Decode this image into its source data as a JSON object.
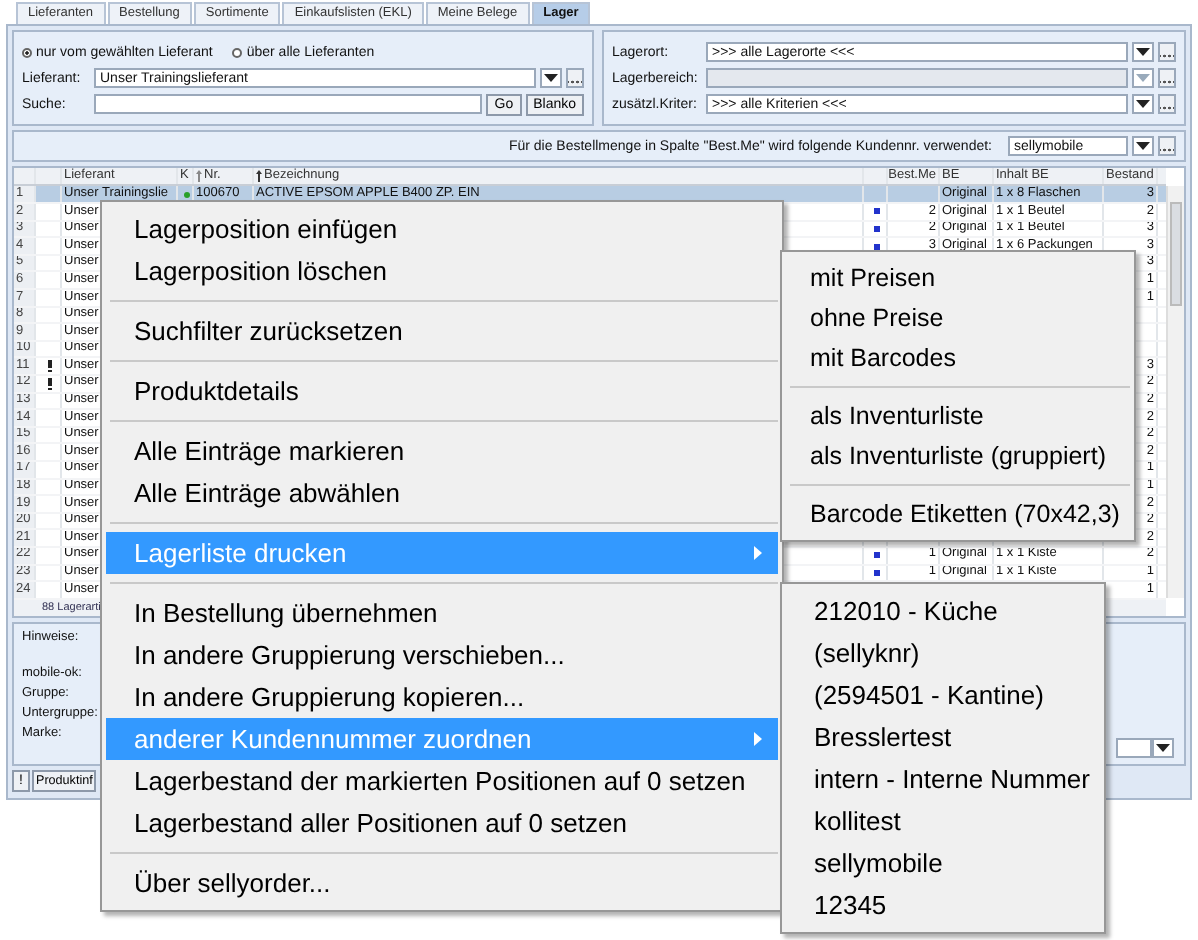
{
  "tabs": [
    {
      "label": "Lieferanten",
      "selected": false
    },
    {
      "label": "Bestellung",
      "selected": false
    },
    {
      "label": "Sortimente",
      "selected": false
    },
    {
      "label": "Einkaufslisten (EKL)",
      "selected": false
    },
    {
      "label": "Meine Belege",
      "selected": false
    },
    {
      "label": "Lager",
      "selected": true
    }
  ],
  "filter": {
    "radios": [
      {
        "label": "nur vom gewählten Lieferant",
        "selected": true
      },
      {
        "label": "über alle Lieferanten",
        "selected": false
      }
    ],
    "lieferant_label": "Lieferant:",
    "lieferant_value": "Unser Trainingslieferant",
    "search_label": "Suche:",
    "go_button": "Go",
    "blank_button": "Blanko"
  },
  "storage": {
    "fields": [
      {
        "label": "Lagerort:",
        "value": ">>> alle Lagerorte <<<",
        "disabled": false
      },
      {
        "label": "Lagerbereich:",
        "disabled": true
      },
      {
        "label": "zusätzl.Kriter:",
        "value": ">>> alle Kriterien <<<",
        "disabled": false
      }
    ]
  },
  "customer": {
    "label": "Für die Bestellmenge in Spalte \"Best.Me\" wird folgende Kundennr. verwendet:",
    "value": "sellymobile"
  },
  "table": {
    "columns": [
      "Lieferant",
      "K",
      "Nr.",
      "Bezeichnung",
      "Best.Me",
      "BE",
      "Inhalt BE",
      "Bestand"
    ],
    "rows": [
      {
        "n": "1",
        "warning": false,
        "lieferant": "Unser Trainingslie",
        "k_ok": true,
        "nr": "100670",
        "bezeichnung": "ACTIVE EPSOM APPLE B400 ZP. EIN",
        "marked": false,
        "be": "Original",
        "inhalt": "1 x 8 Flaschen",
        "bestand": "3",
        "selected": true
      },
      {
        "n": "2",
        "warning": false,
        "lieferant": "Unser",
        "marked": true,
        "best_me": "2",
        "be": "Original",
        "inhalt": "1 x 1 Beutel",
        "bestand": "2",
        "selected": false
      },
      {
        "n": "3",
        "warning": false,
        "lieferant": "Unser",
        "marked": true,
        "best_me": "2",
        "be": "Original",
        "inhalt": "1 x 1 Beutel",
        "bestand": "3",
        "selected": false
      },
      {
        "n": "4",
        "warning": false,
        "lieferant": "Unser",
        "marked": true,
        "best_me": "3",
        "be": "Original",
        "inhalt": "1 x 6 Packungen",
        "bestand": "3",
        "selected": false
      },
      {
        "n": "5",
        "warning": false,
        "lieferant": "Unser",
        "bestand": "3",
        "selected": false
      },
      {
        "n": "6",
        "warning": false,
        "lieferant": "Unser",
        "bestand": "1",
        "selected": false
      },
      {
        "n": "7",
        "warning": false,
        "lieferant": "Unser",
        "bestand": "1",
        "selected": false
      },
      {
        "n": "8",
        "warning": false,
        "lieferant": "Unser",
        "selected": false
      },
      {
        "n": "9",
        "warning": false,
        "lieferant": "Unser",
        "selected": false
      },
      {
        "n": "10",
        "warning": false,
        "lieferant": "Unser",
        "selected": false
      },
      {
        "n": "11",
        "warning": true,
        "lieferant": "Unser",
        "bestand": "3",
        "selected": false
      },
      {
        "n": "12",
        "warning": true,
        "lieferant": "Unser",
        "bestand": "2",
        "selected": false
      },
      {
        "n": "13",
        "warning": false,
        "lieferant": "Unser",
        "bestand": "2",
        "selected": false
      },
      {
        "n": "14",
        "warning": false,
        "lieferant": "Unser",
        "bestand": "2",
        "selected": false
      },
      {
        "n": "15",
        "warning": false,
        "lieferant": "Unser",
        "bestand": "2",
        "selected": false
      },
      {
        "n": "16",
        "warning": false,
        "lieferant": "Unser",
        "bestand": "2",
        "selected": false
      },
      {
        "n": "17",
        "warning": false,
        "lieferant": "Unser",
        "bestand": "1",
        "selected": false
      },
      {
        "n": "18",
        "warning": false,
        "lieferant": "Unser",
        "bestand": "1",
        "selected": false
      },
      {
        "n": "19",
        "warning": false,
        "lieferant": "Unser",
        "bestand": "2",
        "selected": false
      },
      {
        "n": "20",
        "warning": false,
        "lieferant": "Unser",
        "bestand": "2",
        "selected": false
      },
      {
        "n": "21",
        "warning": false,
        "lieferant": "Unser",
        "bestand": "2",
        "selected": false
      },
      {
        "n": "22",
        "warning": false,
        "lieferant": "Unser",
        "marked": true,
        "best_me": "1",
        "be": "Original",
        "inhalt": "1 x 1 Kiste",
        "bestand": "2",
        "selected": false
      },
      {
        "n": "23",
        "warning": false,
        "lieferant": "Unser",
        "marked": true,
        "best_me": "1",
        "be": "Original",
        "inhalt": "1 x 1 Kiste",
        "bestand": "1",
        "selected": false
      },
      {
        "n": "24",
        "warning": false,
        "lieferant": "Unser",
        "bestand": "1",
        "selected": false
      }
    ],
    "footer": "88 Lagerarti"
  },
  "info": {
    "labels": [
      "Hinweise:",
      "mobile-ok:",
      "Gruppe:",
      "Untergruppe:",
      "Marke:"
    ]
  },
  "bottom_bar": {
    "warning_button": "!",
    "product_button": "Produktinf"
  },
  "context_menu": [
    {
      "kind": "item",
      "label": "Lagerposition einfügen",
      "highlighted": false,
      "submenu": false
    },
    {
      "kind": "item",
      "label": "Lagerposition löschen",
      "highlighted": false,
      "submenu": false
    },
    {
      "kind": "separator"
    },
    {
      "kind": "item",
      "label": "Suchfilter zurücksetzen",
      "highlighted": false,
      "submenu": false
    },
    {
      "kind": "separator"
    },
    {
      "kind": "item",
      "label": "Produktdetails",
      "highlighted": false,
      "submenu": false
    },
    {
      "kind": "separator"
    },
    {
      "kind": "item",
      "label": "Alle Einträge markieren",
      "highlighted": false,
      "submenu": false
    },
    {
      "kind": "item",
      "label": "Alle Einträge abwählen",
      "highlighted": false,
      "submenu": false
    },
    {
      "kind": "separator"
    },
    {
      "kind": "item",
      "label": "Lagerliste drucken",
      "highlighted": true,
      "submenu": true
    },
    {
      "kind": "separator"
    },
    {
      "kind": "item",
      "label": "In Bestellung übernehmen",
      "highlighted": false,
      "submenu": false
    },
    {
      "kind": "item",
      "label": "In andere Gruppierung verschieben...",
      "highlighted": false,
      "submenu": false
    },
    {
      "kind": "item",
      "label": "In andere Gruppierung kopieren...",
      "highlighted": false,
      "submenu": false
    },
    {
      "kind": "item",
      "label": "anderer Kundennummer zuordnen",
      "highlighted": true,
      "submenu": true
    },
    {
      "kind": "item",
      "label": "Lagerbestand der markierten Positionen auf 0 setzen",
      "highlighted": false,
      "submenu": false
    },
    {
      "kind": "item",
      "label": "Lagerbestand aller Positionen auf 0 setzen",
      "highlighted": false,
      "submenu": false
    },
    {
      "kind": "separator"
    },
    {
      "kind": "item",
      "label": "Über sellyorder...",
      "highlighted": false,
      "submenu": false
    }
  ],
  "print_submenu": [
    {
      "kind": "item",
      "label": "mit Preisen"
    },
    {
      "kind": "item",
      "label": "ohne Preise"
    },
    {
      "kind": "item",
      "label": "mit Barcodes"
    },
    {
      "kind": "separator"
    },
    {
      "kind": "item",
      "label": "als Inventurliste"
    },
    {
      "kind": "item",
      "label": "als Inventurliste (gruppiert)"
    },
    {
      "kind": "separator"
    },
    {
      "kind": "item",
      "label": "Barcode Etiketten (70x42,3)"
    }
  ],
  "customer_submenu": [
    {
      "kind": "item",
      "label": "212010 - Küche"
    },
    {
      "kind": "item",
      "label": "(sellyknr)"
    },
    {
      "kind": "item",
      "label": "(2594501 - Kantine)"
    },
    {
      "kind": "item",
      "label": "Bresslertest"
    },
    {
      "kind": "item",
      "label": "intern - Interne Nummer"
    },
    {
      "kind": "item",
      "label": "kollitest"
    },
    {
      "kind": "item",
      "label": "sellymobile"
    },
    {
      "kind": "item",
      "label": "12345"
    }
  ]
}
